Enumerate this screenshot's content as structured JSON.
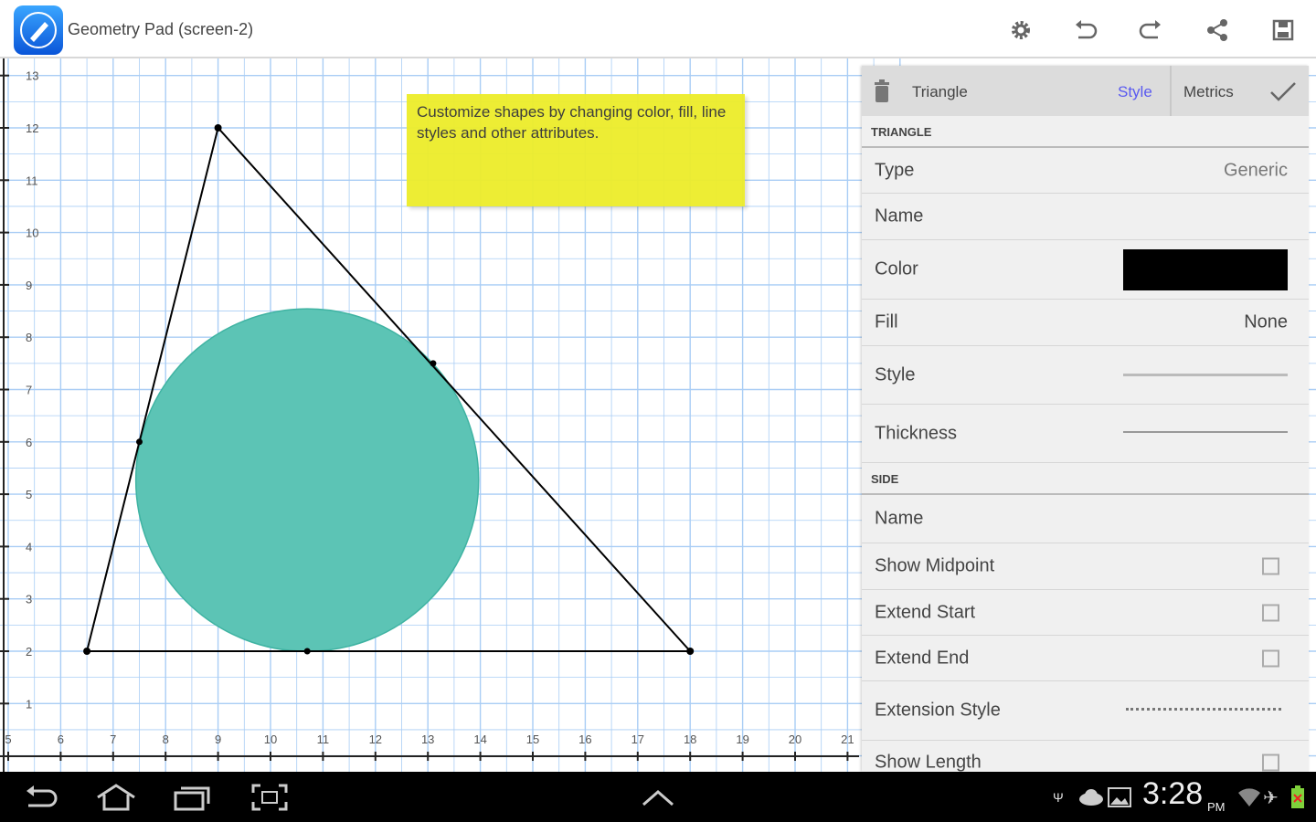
{
  "app": {
    "title": "Geometry Pad (screen-2)"
  },
  "toolbar": {
    "icons": [
      "gear-icon",
      "undo-icon",
      "redo-icon",
      "share-icon",
      "save-icon"
    ]
  },
  "canvas": {
    "x_ticks": [
      5,
      6,
      7,
      8,
      9,
      10,
      11,
      12,
      13,
      14,
      15,
      16,
      17,
      18,
      19,
      20,
      21
    ],
    "y_ticks": [
      1,
      2,
      3,
      4,
      5,
      6,
      7,
      8,
      9,
      10,
      11,
      12,
      13
    ],
    "grid_color": "#a9cdf5",
    "triangle": {
      "vertices": [
        [
          9,
          12
        ],
        [
          6.5,
          2
        ],
        [
          18,
          2
        ]
      ],
      "color": "#000000"
    },
    "circle": {
      "center": [
        10.7,
        5.27
      ],
      "radius": 3.27,
      "fill": "#5cc4b5"
    },
    "tangent_points": [
      [
        7.5,
        6
      ],
      [
        13.1,
        7.5
      ],
      [
        10.7,
        2
      ]
    ]
  },
  "note": {
    "text": "Customize shapes by changing color, fill, line styles and other attributes.",
    "color": "#eded2a"
  },
  "panel": {
    "shape_name": "Triangle",
    "tab_style": "Style",
    "tab_metrics": "Metrics",
    "accent": "#5a5af0",
    "section_triangle": "TRIANGLE",
    "type_label": "Type",
    "type_value": "Generic",
    "name_label": "Name",
    "color_label": "Color",
    "color_value": "#000000",
    "fill_label": "Fill",
    "fill_value": "None",
    "style_label": "Style",
    "thickness_label": "Thickness",
    "section_side": "SIDE",
    "side_name_label": "Name",
    "show_midpoint_label": "Show Midpoint",
    "show_midpoint": false,
    "extend_start_label": "Extend Start",
    "extend_start": false,
    "extend_end_label": "Extend End",
    "extend_end": false,
    "extension_style_label": "Extension Style",
    "show_length_label": "Show Length",
    "show_length": false
  },
  "statusbar": {
    "time": "3:28",
    "ampm": "PM"
  }
}
